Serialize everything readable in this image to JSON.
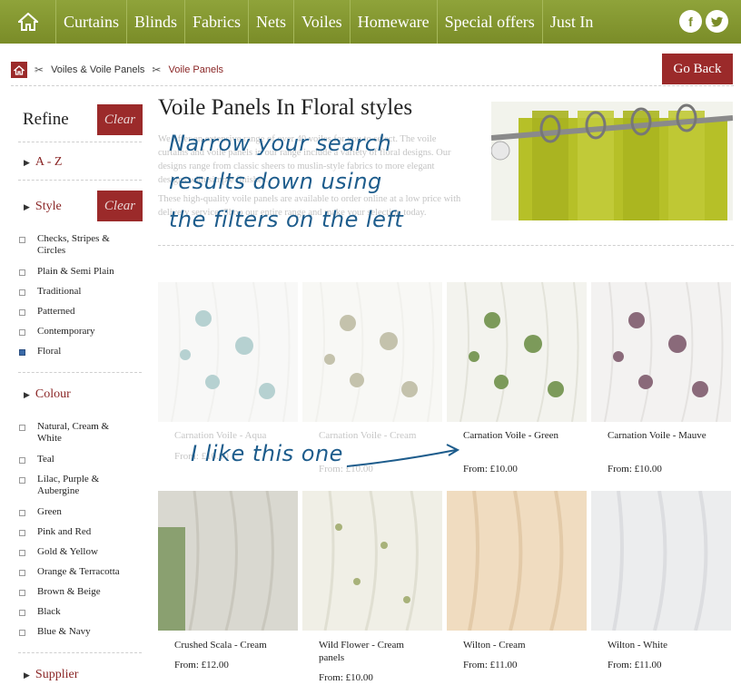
{
  "nav": {
    "items": [
      "Curtains",
      "Blinds",
      "Fabrics",
      "Nets",
      "Voiles",
      "Homeware",
      "Special offers",
      "Just In"
    ],
    "social": {
      "facebook": "f",
      "twitter": "t"
    }
  },
  "breadcrumb": {
    "items": [
      "Voiles & Voile Panels",
      "Voile Panels"
    ]
  },
  "go_back_label": "Go Back",
  "sidebar": {
    "refine_label": "Refine",
    "clear_label": "Clear",
    "az_label": "A - Z",
    "style": {
      "label": "Style",
      "options": [
        {
          "label": "Checks, Stripes & Circles",
          "checked": false
        },
        {
          "label": "Plain & Semi Plain",
          "checked": false
        },
        {
          "label": "Traditional",
          "checked": false
        },
        {
          "label": "Patterned",
          "checked": false
        },
        {
          "label": "Contemporary",
          "checked": false
        },
        {
          "label": "Floral",
          "checked": true
        }
      ]
    },
    "colour": {
      "label": "Colour",
      "options": [
        "Natural, Cream & White",
        "Teal",
        "Lilac, Purple & Aubergine",
        "Green",
        "Pink and Red",
        "Gold & Yellow",
        "Orange & Terracotta",
        "Brown & Beige",
        "Black",
        "Blue & Navy"
      ]
    },
    "supplier_label": "Supplier"
  },
  "main": {
    "title": "Voile Panels In Floral styles",
    "intro_p1": "We offer an extensive range of over 40 voiles for you to select. The voile curtains and voile panels in our range include a variety of floral designs. Our designs range from classic sheers to muslin-style fabrics to more elegant designs with simple finishes.",
    "intro_p2": "These high-quality voile panels are available to order online at a low price with delivery service. Shop our entire range and make your selection today."
  },
  "annotations": {
    "narrow_line1": "Narrow your search",
    "narrow_line2": "results down using",
    "narrow_line3": "the filters on the left",
    "like_note": "I like this one"
  },
  "products": [
    {
      "name": "Carnation Voile - Aqua",
      "price": "From: £10.00"
    },
    {
      "name": "Carnation Voile - Cream",
      "price": "From: £10.00"
    },
    {
      "name": "Carnation Voile - Green",
      "price": "From: £10.00"
    },
    {
      "name": "Carnation Voile - Mauve",
      "price": "From: £10.00"
    },
    {
      "name": "Crushed Scala - Cream",
      "price": "From: £12.00"
    },
    {
      "name": "Wild Flower - Cream panels",
      "price": "From: £10.00"
    },
    {
      "name": "Wilton - Cream",
      "price": "From: £11.00"
    },
    {
      "name": "Wilton - White",
      "price": "From: £11.00"
    }
  ],
  "colors": {
    "nav_green": "#7a8c28",
    "brand_red": "#9b2a2a",
    "annotation_blue": "#1d5c8c"
  }
}
